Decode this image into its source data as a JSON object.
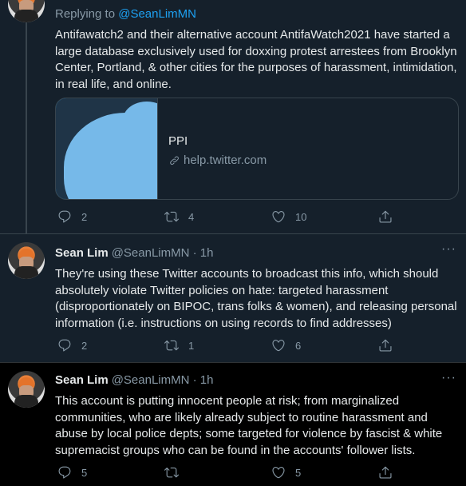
{
  "tweets": [
    {
      "reply_prefix": "Replying to ",
      "reply_handle": "@SeanLimMN",
      "text": "Antifawatch2 and their alternative account AntifaWatch2021 have started a large database exclusively used for doxxing protest arrestees from Brooklyn Center, Portland, & other cities for the purposes of harassment, intimidation, in real life, and online.",
      "card": {
        "title": "PPI",
        "domain": "help.twitter.com"
      },
      "reply_count": "2",
      "retweet_count": "4",
      "like_count": "10"
    },
    {
      "name": "Sean Lim",
      "handle": "@SeanLimMN · 1h",
      "text": "They're using these Twitter accounts to broadcast this info, which should absolutely violate Twitter policies on hate: targeted harassment (disproportionately on BIPOC, trans folks & women), and releasing personal information (i.e. instructions on using records to find addresses)",
      "reply_count": "2",
      "retweet_count": "1",
      "like_count": "6"
    },
    {
      "name": "Sean Lim",
      "handle": "@SeanLimMN · 1h",
      "text": "This account is putting innocent people at risk; from marginalized communities, who are likely already subject to routine harassment and abuse by local police depts; some targeted for violence by fascist & white supremacist groups who can be found in the accounts' follower lists.",
      "reply_count": "5",
      "retweet_count": "",
      "like_count": "5"
    }
  ],
  "more_label": "···",
  "icons": {
    "reply": "reply-icon",
    "retweet": "retweet-icon",
    "like": "like-icon",
    "share": "share-icon",
    "link": "link-icon"
  },
  "colors": {
    "background_dim": "#15202b",
    "background_black": "#000000",
    "accent": "#1da1f2",
    "secondary_text": "#8899a6",
    "border": "#38444d"
  }
}
